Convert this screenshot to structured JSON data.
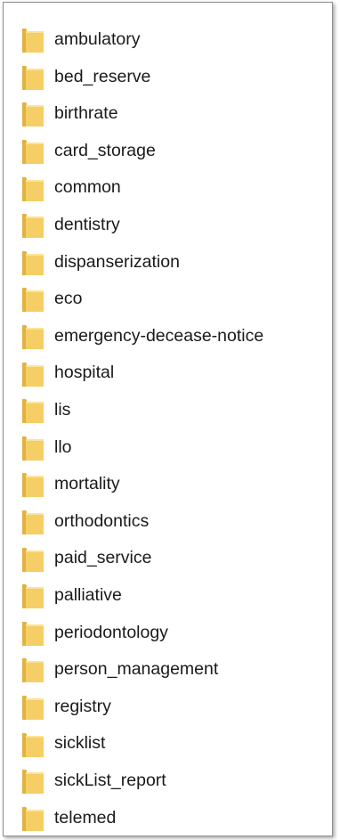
{
  "icon": "folder-icon",
  "folder_color": "#F5CE66",
  "folder_tab_color": "#E2B23E",
  "folders": [
    "ambulatory",
    "bed_reserve",
    "birthrate",
    "card_storage",
    "common",
    "dentistry",
    "dispanserization",
    "eco",
    "emergency-decease-notice",
    "hospital",
    "lis",
    "llo",
    "mortality",
    "orthodontics",
    "paid_service",
    "palliative",
    "periodontology",
    "person_management",
    "registry",
    "sicklist",
    "sickList_report",
    "telemed"
  ]
}
